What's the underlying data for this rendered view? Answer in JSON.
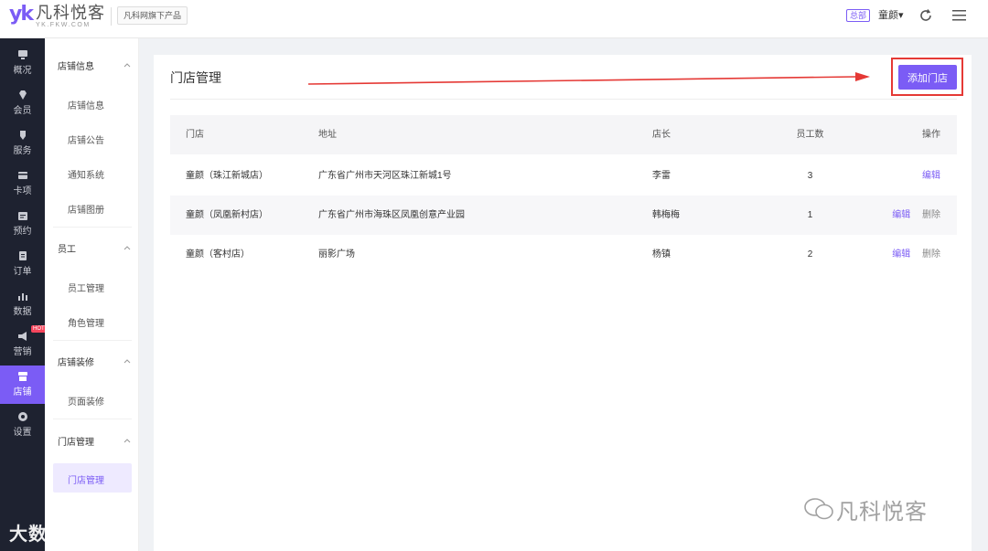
{
  "header": {
    "logo_mark": "yk",
    "logo_name": "凡科悦客",
    "logo_url": "YK.FKW.COM",
    "brand_tag": "凡科网旗下产品",
    "hq_badge": "总部",
    "user_name": "童颜▾",
    "accent": "#7b5cf5"
  },
  "nav": [
    {
      "label": "概况",
      "icon": "monitor-icon"
    },
    {
      "label": "会员",
      "icon": "diamond-icon"
    },
    {
      "label": "服务",
      "icon": "service-icon"
    },
    {
      "label": "卡项",
      "icon": "card-icon"
    },
    {
      "label": "预约",
      "icon": "calendar-icon"
    },
    {
      "label": "订单",
      "icon": "order-icon"
    },
    {
      "label": "数据",
      "icon": "bar-chart-icon"
    },
    {
      "label": "营销",
      "icon": "megaphone-icon",
      "badge": "HOT"
    },
    {
      "label": "店铺",
      "icon": "store-icon",
      "active": true
    },
    {
      "label": "设置",
      "icon": "gear-icon"
    }
  ],
  "submenu": {
    "groups": [
      {
        "title": "店铺信息",
        "items": [
          "店铺信息",
          "店铺公告",
          "通知系统",
          "店铺图册"
        ]
      },
      {
        "title": "员工",
        "items": [
          "员工管理",
          "角色管理"
        ]
      },
      {
        "title": "店铺装修",
        "items": [
          "页面装修"
        ]
      },
      {
        "title": "门店管理",
        "items": [
          "门店管理"
        ]
      }
    ]
  },
  "main": {
    "title": "门店管理",
    "add_button": "添加门店",
    "table": {
      "headers": [
        "门店",
        "地址",
        "店长",
        "员工数",
        "操作"
      ],
      "rows": [
        {
          "store": "童颜（珠江新城店）",
          "address": "广东省广州市天河区珠江新城1号",
          "manager": "李雷",
          "staff": "3",
          "ops": [
            "编辑"
          ]
        },
        {
          "store": "童颜（凤凰新村店）",
          "address": "广东省广州市海珠区凤凰创意产业园",
          "manager": "韩梅梅",
          "staff": "1",
          "ops": [
            "编辑",
            "删除"
          ]
        },
        {
          "store": "童颜（客村店）",
          "address": "丽影广场",
          "manager": "杨镇",
          "staff": "2",
          "ops": [
            "编辑",
            "删除"
          ]
        }
      ]
    }
  },
  "watermarks": {
    "left": "大数跨境",
    "right": "凡科悦客"
  },
  "annotation_color": "#e53935"
}
